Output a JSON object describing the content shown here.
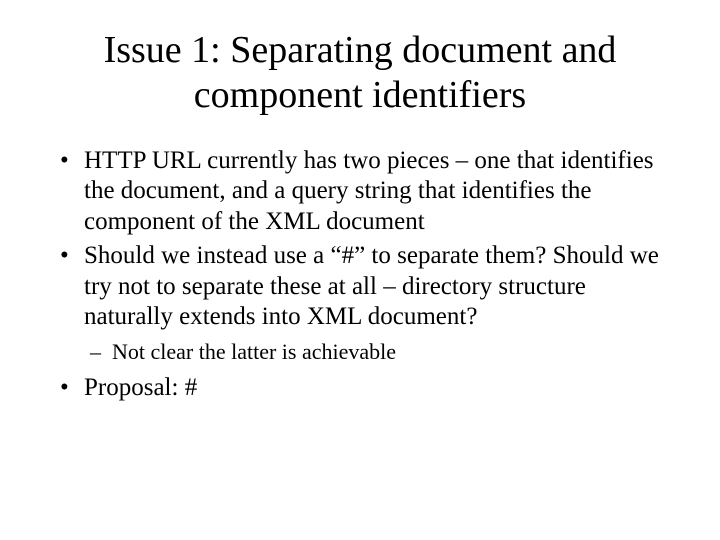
{
  "title": "Issue 1: Separating document and component identifiers",
  "bullets": {
    "b1": "HTTP URL currently has two pieces – one that identifies the document, and a query string that identifies the component of the XML document",
    "b2": "Should we instead use a “#” to separate them? Should we try not to separate these at all – directory structure naturally extends into XML document?",
    "b2sub1": "Not clear the latter is achievable",
    "b3": "Proposal: #"
  }
}
